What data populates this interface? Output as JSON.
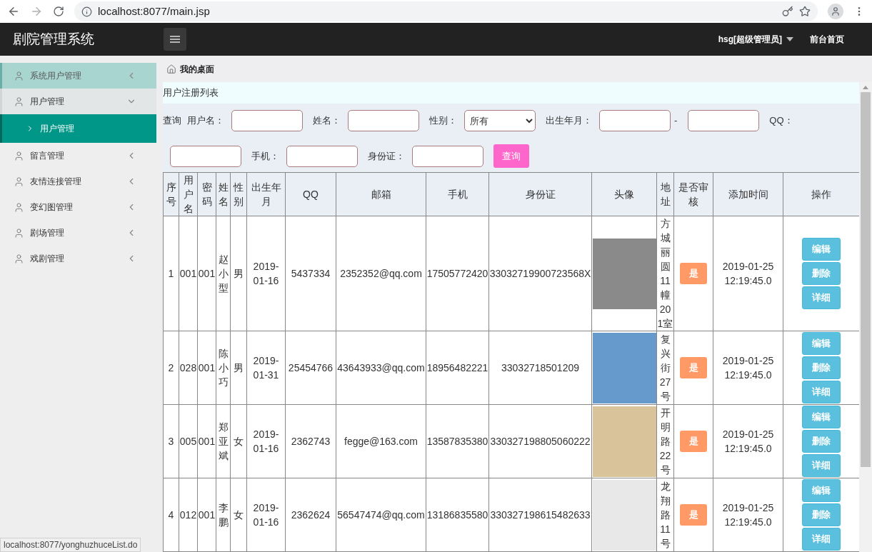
{
  "browser": {
    "url": "localhost:8077/main.jsp",
    "status_url": "localhost:8077/yonghuzhuceList.do"
  },
  "header": {
    "title": "剧院管理系统",
    "user_menu": "hsg[超级管理员]",
    "front_link": "前台首页"
  },
  "sidebar": {
    "items": [
      {
        "label": "系统用户管理",
        "selected": true,
        "expanded": false
      },
      {
        "label": "用户管理",
        "selected": false,
        "expanded": true,
        "children": [
          {
            "label": "用户管理",
            "selected": true
          }
        ]
      },
      {
        "label": "留言管理",
        "selected": false,
        "expanded": false
      },
      {
        "label": "友情连接管理",
        "selected": false,
        "expanded": false
      },
      {
        "label": "变幻图管理",
        "selected": false,
        "expanded": false
      },
      {
        "label": "剧场管理",
        "selected": false,
        "expanded": false
      },
      {
        "label": "戏剧管理",
        "selected": false,
        "expanded": false
      }
    ]
  },
  "breadcrumb": "我的桌面",
  "panel_title": "用户注册列表",
  "search": {
    "prefix": "查询",
    "fields": [
      {
        "kind": "text",
        "label": "用户名："
      },
      {
        "kind": "text",
        "label": "姓名："
      },
      {
        "kind": "select",
        "label": "性别：",
        "value": "所有"
      },
      {
        "kind": "range",
        "label": "出生年月：",
        "separator": "-"
      },
      {
        "kind": "text",
        "label": "QQ："
      },
      {
        "kind": "text",
        "label": "手机："
      },
      {
        "kind": "text",
        "label": "身份证："
      }
    ],
    "button": "查询"
  },
  "table": {
    "columns": [
      "序号",
      "用户名",
      "密码",
      "姓名",
      "性别",
      "出生年月",
      "QQ",
      "邮箱",
      "手机",
      "身份证",
      "头像",
      "地址",
      "是否审核",
      "添加时间",
      "操作"
    ],
    "rows": [
      {
        "cells": [
          "1",
          "001",
          "001",
          "赵小型",
          "男",
          "2019-01-16",
          "5437334",
          "2352352@qq.com",
          "17505772420",
          "33032719900723568X"
        ],
        "address": "方城丽圆11幢201室",
        "approved": "是",
        "added": "2019-01-25 12:19:45.0",
        "actions": [
          "编辑",
          "删除",
          "详细"
        ]
      },
      {
        "cells": [
          "2",
          "028",
          "001",
          "陈小巧",
          "男",
          "2019-01-31",
          "25454766",
          "43643933@qq.com",
          "18956482221",
          "33032718501209"
        ],
        "address": "复兴街27号",
        "approved": "是",
        "added": "2019-01-25 12:19:45.0",
        "actions": [
          "编辑",
          "删除",
          "详细"
        ]
      },
      {
        "cells": [
          "3",
          "005",
          "001",
          "郑亚斌",
          "女",
          "2019-01-16",
          "2362743",
          "fegge@163.com",
          "13587835380",
          "330327198805060222"
        ],
        "address": "开明路22号",
        "approved": "是",
        "added": "2019-01-25 12:19:45.0",
        "actions": [
          "编辑",
          "删除",
          "详细"
        ]
      },
      {
        "cells": [
          "4",
          "012",
          "001",
          "李鹏",
          "女",
          "2019-01-16",
          "2362624",
          "56547474@qq.com",
          "13186835580",
          "330327198615482633"
        ],
        "address": "龙翔路11号",
        "approved": "是",
        "added": "2019-01-25 12:19:45.0",
        "actions": [
          "编辑",
          "删除",
          "详细"
        ]
      }
    ]
  }
}
